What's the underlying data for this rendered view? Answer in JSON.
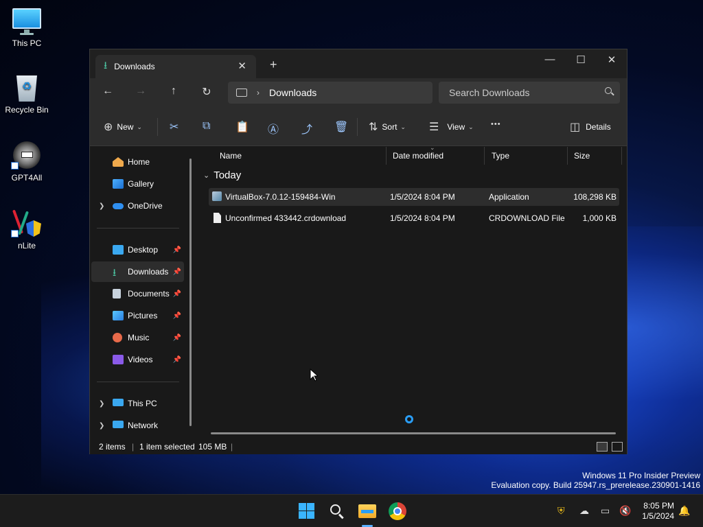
{
  "desktop": {
    "icons": [
      {
        "label": "This PC",
        "icon": "monitor-icon"
      },
      {
        "label": "Recycle Bin",
        "icon": "recycle-bin-icon"
      },
      {
        "label": "GPT4All",
        "icon": "gpt4all-icon"
      },
      {
        "label": "nLite",
        "icon": "nlite-icon"
      }
    ],
    "watermark": {
      "line1": "Windows 11 Pro Insider Preview",
      "line2": "Evaluation copy. Build 25947.rs_prerelease.230901-1416"
    }
  },
  "window": {
    "tab_title": "Downloads",
    "new_tab": "+",
    "controls": {
      "minimize": "—",
      "maximize": "☐",
      "close": "✕"
    },
    "nav": {
      "back": "←",
      "forward": "→",
      "up": "↑",
      "refresh": "↻"
    },
    "address": {
      "location": "Downloads"
    },
    "search": {
      "placeholder": "Search Downloads"
    },
    "toolbar": {
      "new_label": "New",
      "sort_label": "Sort",
      "view_label": "View",
      "more": "•••",
      "details_label": "Details"
    },
    "sidebar": {
      "quick": [
        {
          "label": "Home",
          "icon": "home-icon"
        },
        {
          "label": "Gallery",
          "icon": "gallery-icon"
        },
        {
          "label": "OneDrive",
          "icon": "onedrive-icon"
        }
      ],
      "pinned": [
        {
          "label": "Desktop",
          "icon": "desktop-folder-icon"
        },
        {
          "label": "Downloads",
          "icon": "downloads-folder-icon"
        },
        {
          "label": "Documents",
          "icon": "documents-folder-icon"
        },
        {
          "label": "Pictures",
          "icon": "pictures-folder-icon"
        },
        {
          "label": "Music",
          "icon": "music-folder-icon"
        },
        {
          "label": "Videos",
          "icon": "videos-folder-icon"
        }
      ],
      "bottom": [
        {
          "label": "This PC",
          "icon": "this-pc-icon"
        },
        {
          "label": "Network",
          "icon": "network-icon"
        }
      ]
    },
    "columns": [
      "Name",
      "Date modified",
      "Type",
      "Size"
    ],
    "group": "Today",
    "files": [
      {
        "name": "VirtualBox-7.0.12-159484-Win",
        "date": "1/5/2024 8:04 PM",
        "type": "Application",
        "size": "108,298 KB",
        "icon": "installer-icon"
      },
      {
        "name": "Unconfirmed 433442.crdownload",
        "date": "1/5/2024 8:04 PM",
        "type": "CRDOWNLOAD File",
        "size": "1,000 KB",
        "icon": "file-icon"
      }
    ],
    "status": {
      "count": "2 items",
      "selected": "1 item selected",
      "size": "105 MB"
    }
  },
  "taskbar": {
    "apps": [
      "start-icon",
      "search-icon",
      "file-explorer-icon",
      "chrome-icon"
    ],
    "time": "8:05 PM",
    "date": "1/5/2024"
  },
  "colors": {
    "accent": "#4cc2a0",
    "window_bg": "#191919",
    "toolbar_bg": "#2c2c2c"
  }
}
